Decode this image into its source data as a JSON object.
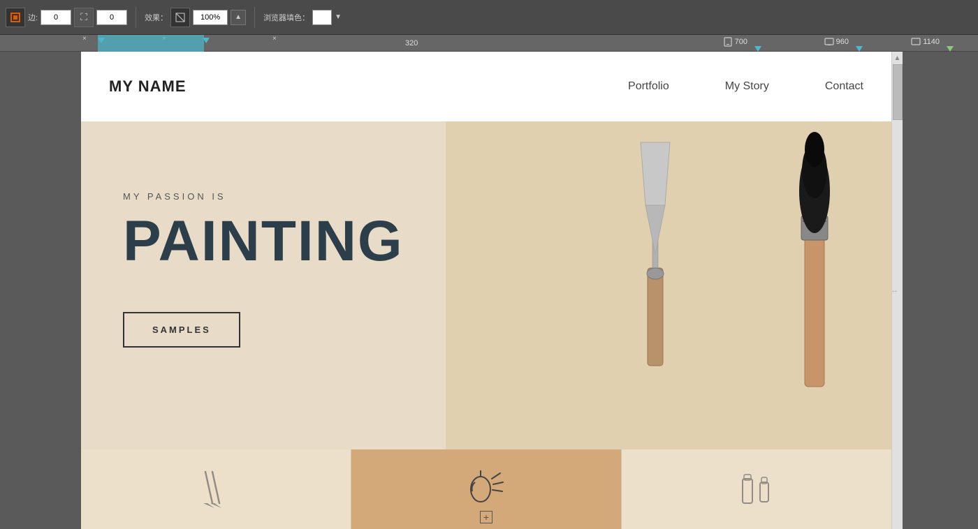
{
  "toolbar": {
    "border_label": "边:",
    "border_value": "0",
    "position_value": "0",
    "effect_label": "效果：",
    "zoom_value": "100%",
    "browser_color_label": "浏览器填色：",
    "fullscreen_icon": "⛶",
    "zoom_in_icon": "+",
    "zoom_out_icon": "▲"
  },
  "ruler": {
    "breakpoints": [
      {
        "label": "×",
        "position": 116,
        "color": "#4db8cc"
      },
      {
        "label": "×",
        "position": 230,
        "color": "#4db8cc"
      },
      {
        "label": "×",
        "position": 395,
        "color": "#4db8cc"
      }
    ],
    "labels": [
      {
        "text": "320",
        "position": 690
      },
      {
        "text": "700",
        "position": 1070,
        "icon": "📱"
      },
      {
        "text": "960",
        "position": 1215,
        "icon": "📋"
      },
      {
        "text": "1140",
        "position": 1335,
        "icon": "📋"
      }
    ]
  },
  "site": {
    "logo": "MY NAME",
    "nav": {
      "items": [
        {
          "label": "Portfolio",
          "href": "#"
        },
        {
          "label": "My Story",
          "href": "#"
        },
        {
          "label": "Contact",
          "href": "#"
        }
      ]
    },
    "hero": {
      "subtitle": "MY PASSION IS",
      "title": "PAINTING",
      "button_label": "SAMPLES"
    },
    "bottom_grid": {
      "cells": [
        {
          "active": false
        },
        {
          "active": true
        },
        {
          "active": false
        }
      ]
    }
  },
  "scrollbar": {
    "resize_icon": "↔"
  }
}
